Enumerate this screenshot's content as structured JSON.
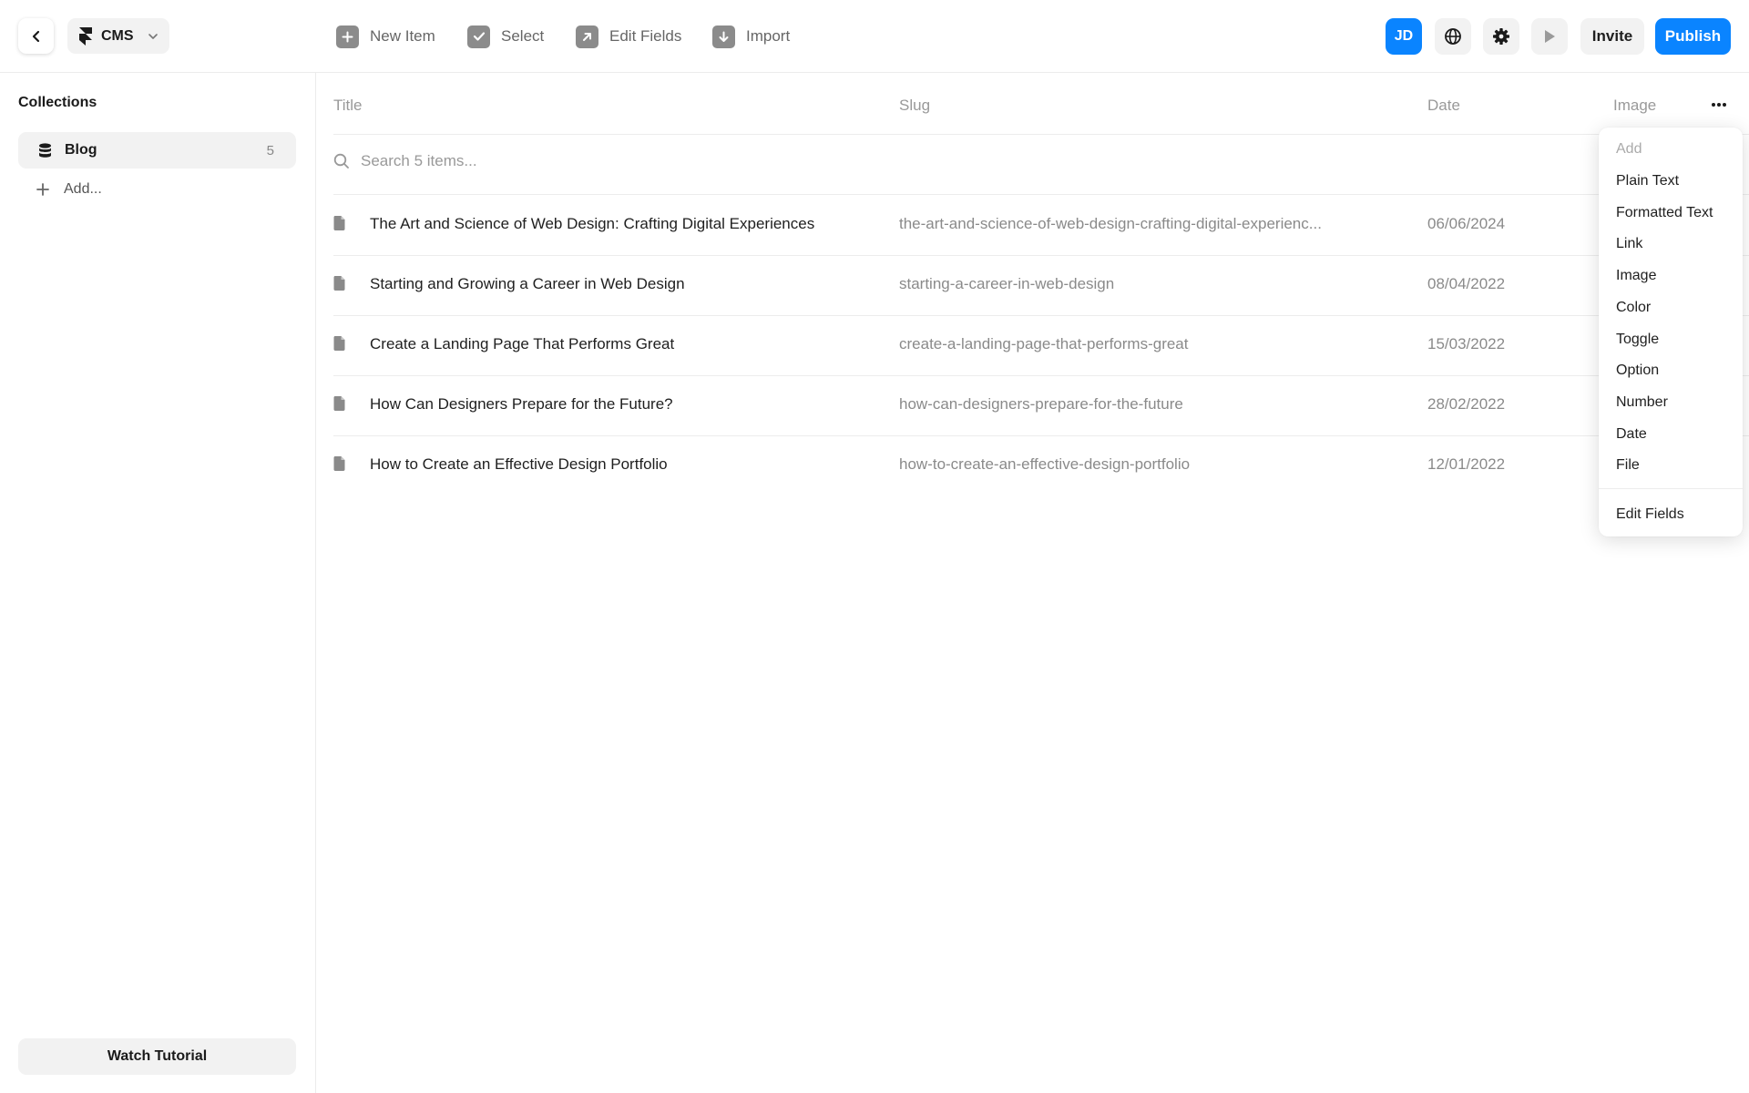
{
  "header": {
    "back_icon": "chevron-left-icon",
    "app_switcher": {
      "label": "CMS",
      "icon": "framer-logo-icon"
    },
    "toolbar": [
      {
        "label": "New Item",
        "icon": "plus-icon"
      },
      {
        "label": "Select",
        "icon": "check-icon"
      },
      {
        "label": "Edit Fields",
        "icon": "arrow-up-right-icon"
      },
      {
        "label": "Import",
        "icon": "arrow-down-icon"
      }
    ],
    "avatar_initials": "JD",
    "invite_label": "Invite",
    "publish_label": "Publish",
    "accent_color": "#0a84ff"
  },
  "sidebar": {
    "title": "Collections",
    "collections": [
      {
        "name": "Blog",
        "count": "5"
      }
    ],
    "add_label": "Add...",
    "watch_tutorial_label": "Watch Tutorial"
  },
  "table": {
    "columns": [
      "Title",
      "Slug",
      "Date",
      "Image"
    ],
    "search_placeholder": "Search 5 items...",
    "rows": [
      {
        "title": "The Art and Science of Web Design: Crafting Digital Experiences",
        "slug": "the-art-and-science-of-web-design-crafting-digital-experienc...",
        "date": "06/06/2024"
      },
      {
        "title": "Starting and Growing a Career in Web Design",
        "slug": "starting-a-career-in-web-design",
        "date": "08/04/2022"
      },
      {
        "title": "Create a Landing Page That Performs Great",
        "slug": "create-a-landing-page-that-performs-great",
        "date": "15/03/2022"
      },
      {
        "title": "How Can Designers Prepare for the Future?",
        "slug": "how-can-designers-prepare-for-the-future",
        "date": "28/02/2022"
      },
      {
        "title": "How to Create an Effective Design Portfolio",
        "slug": "how-to-create-an-effective-design-portfolio",
        "date": "12/01/2022"
      }
    ]
  },
  "field_menu": {
    "heading": "Add",
    "items": [
      "Plain Text",
      "Formatted Text",
      "Link",
      "Image",
      "Color",
      "Toggle",
      "Option",
      "Number",
      "Date",
      "File"
    ],
    "footer_item": "Edit Fields"
  }
}
